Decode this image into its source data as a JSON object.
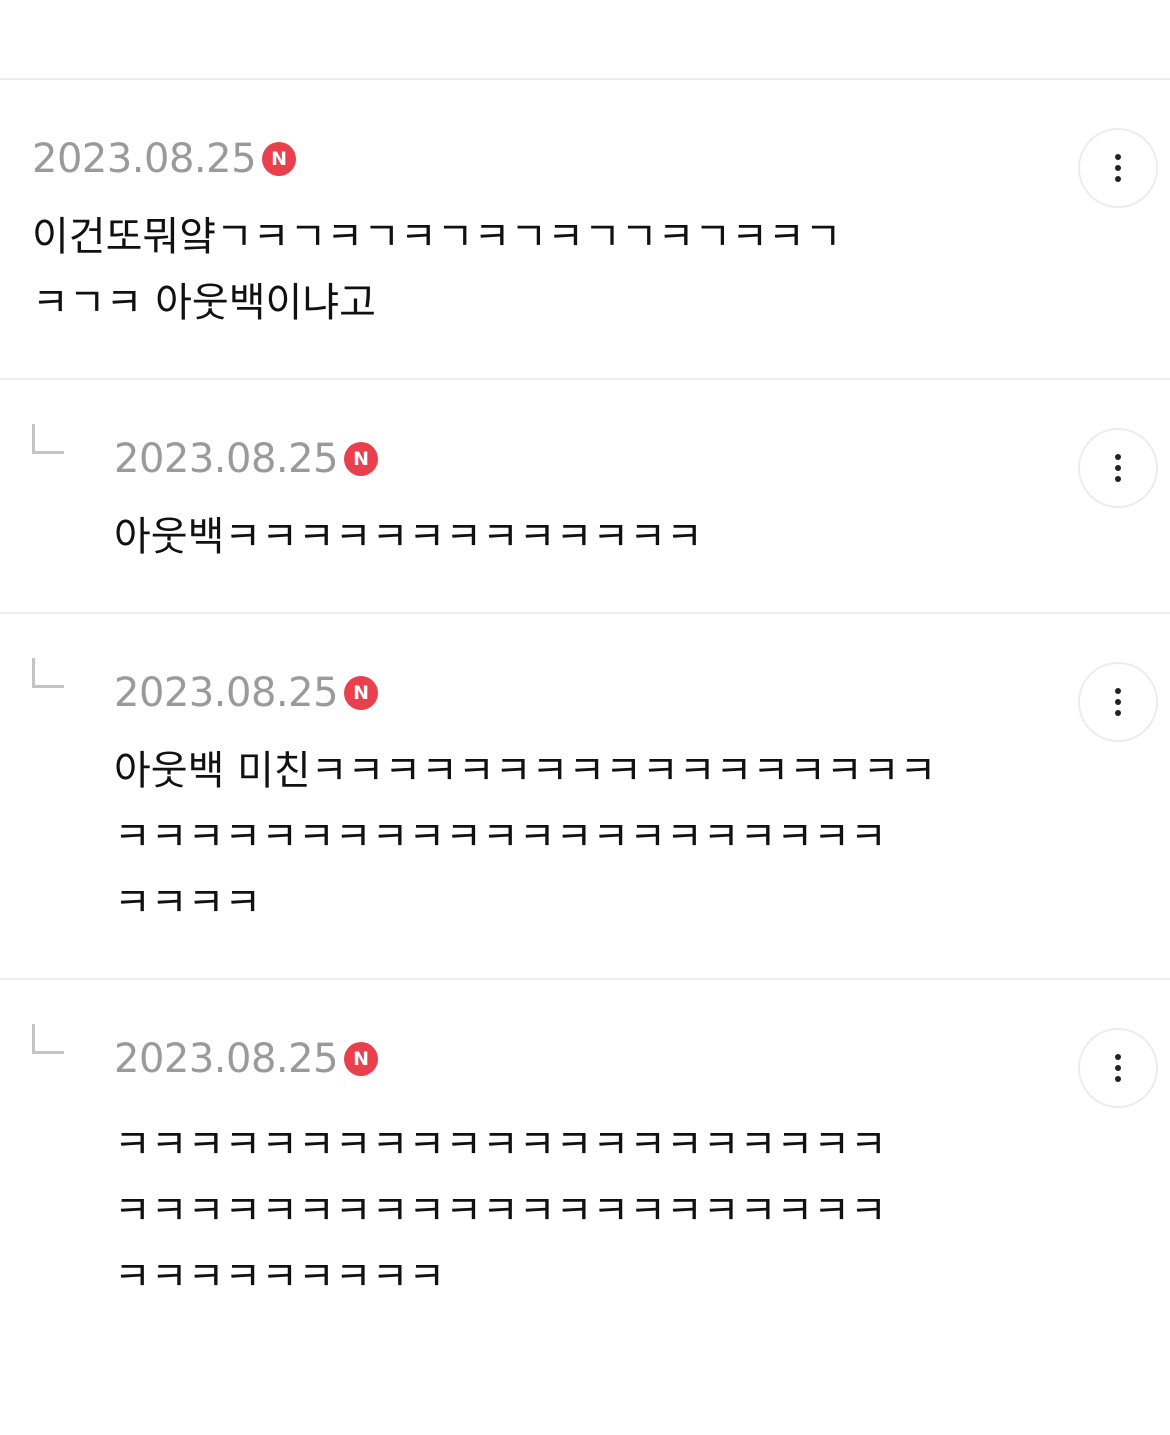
{
  "comments": [
    {
      "date": "2023.08.25",
      "badge": "N",
      "lines": [
        "이건또뭐얔ㄱㅋㄱㅋㄱㅋㄱㅋㄱㅋㄱㄱㅋㄱㅋㅋㄱ",
        "ㅋㄱㅋ 아웃백이냐고"
      ]
    },
    {
      "date": "2023.08.25",
      "badge": "N",
      "lines": [
        "아웃백ㅋㅋㅋㅋㅋㅋㅋㅋㅋㅋㅋㅋㅋ"
      ]
    },
    {
      "date": "2023.08.25",
      "badge": "N",
      "lines": [
        "아웃백 미친ㅋㅋㅋㅋㅋㅋㅋㅋㅋㅋㅋㅋㅋㅋㅋㅋㅋ",
        "ㅋㅋㅋㅋㅋㅋㅋㅋㅋㅋㅋㅋㅋㅋㅋㅋㅋㅋㅋㅋㅋ",
        "ㅋㅋㅋㅋ"
      ]
    },
    {
      "date": "2023.08.25",
      "badge": "N",
      "lines": [
        "ㅋㅋㅋㅋㅋㅋㅋㅋㅋㅋㅋㅋㅋㅋㅋㅋㅋㅋㅋㅋㅋ",
        "ㅋㅋㅋㅋㅋㅋㅋㅋㅋㅋㅋㅋㅋㅋㅋㅋㅋㅋㅋㅋㅋ",
        "ㅋㅋㅋㅋㅋㅋㅋㅋㅋ"
      ]
    }
  ],
  "icons": {
    "more": "more-vertical-icon",
    "reply": "reply-arrow-icon"
  },
  "colors": {
    "badge": "#e8404c",
    "date": "#9a9a9a",
    "divider": "#ececec"
  }
}
